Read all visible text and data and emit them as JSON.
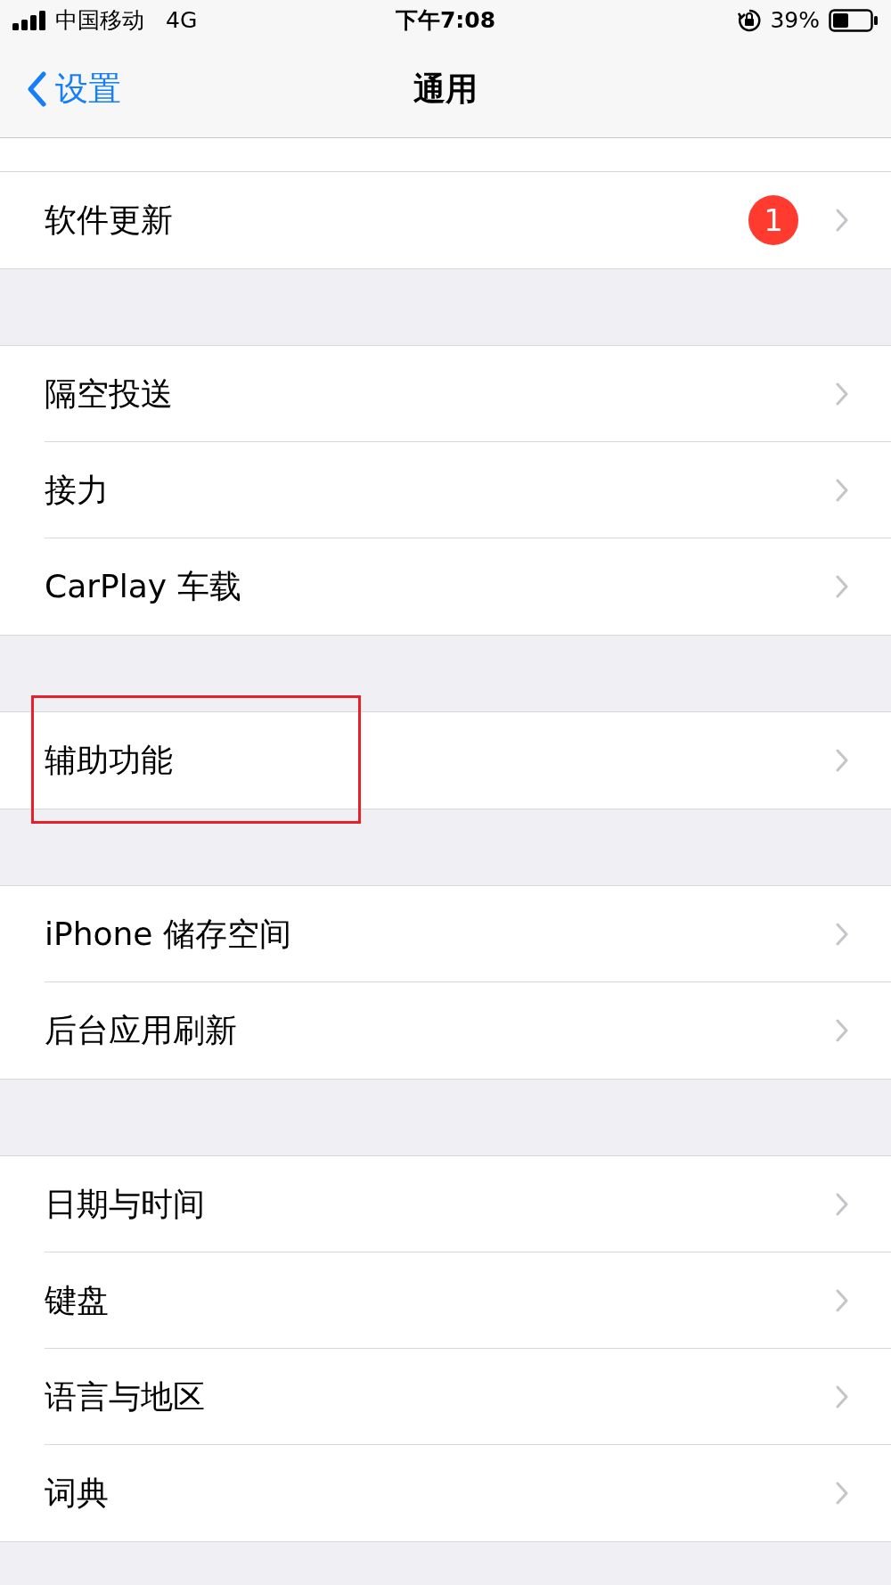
{
  "status_bar": {
    "carrier": "中国移动",
    "network": "4G",
    "time": "下午7:08",
    "battery_text": "39%"
  },
  "nav": {
    "back": "设置",
    "title": "通用"
  },
  "groups": [
    {
      "rows": [
        {
          "label": "软件更新",
          "badge": "1",
          "highlighted": false
        }
      ]
    },
    {
      "rows": [
        {
          "label": "隔空投送",
          "highlighted": false
        },
        {
          "label": "接力",
          "highlighted": false
        },
        {
          "label": "CarPlay 车载",
          "highlighted": false
        }
      ]
    },
    {
      "rows": [
        {
          "label": "辅助功能",
          "highlighted": true
        }
      ]
    },
    {
      "rows": [
        {
          "label": "iPhone 储存空间",
          "highlighted": false
        },
        {
          "label": "后台应用刷新",
          "highlighted": false
        }
      ]
    },
    {
      "rows": [
        {
          "label": "日期与时间",
          "highlighted": false
        },
        {
          "label": "键盘",
          "highlighted": false
        },
        {
          "label": "语言与地区",
          "highlighted": false
        },
        {
          "label": "词典",
          "highlighted": false
        }
      ]
    }
  ]
}
